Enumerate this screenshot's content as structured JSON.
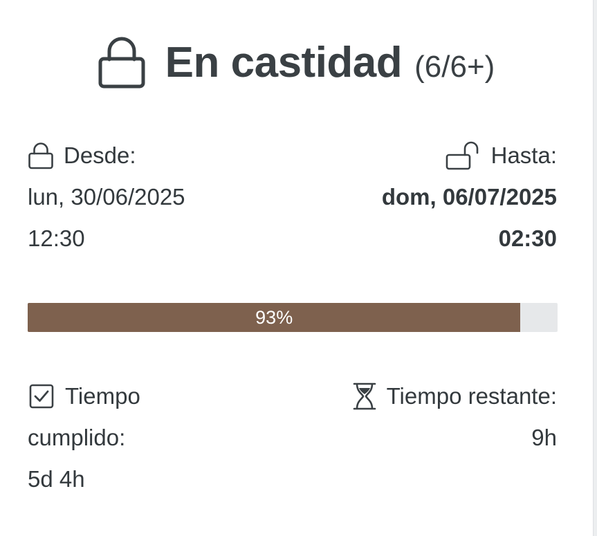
{
  "header": {
    "status_title": "En castidad",
    "count": "(6/6+)",
    "icon": "lock-icon"
  },
  "since": {
    "label": "Desde:",
    "date": "lun, 30/06/2025",
    "time": "12:30",
    "icon": "lock-icon"
  },
  "until": {
    "label": "Hasta:",
    "date": "dom, 06/07/2025",
    "time": "02:30",
    "icon": "unlock-icon"
  },
  "progress": {
    "value": 93,
    "label": "93%",
    "fill_color": "#7e614e",
    "track_color": "#e6e8ea"
  },
  "elapsed": {
    "label_line1": "Tiempo",
    "label_line2": "cumplido:",
    "value": "5d 4h",
    "icon": "checkbox-checked-icon"
  },
  "remaining": {
    "label": "Tiempo restante:",
    "value": "9h",
    "icon": "hourglass-icon"
  }
}
